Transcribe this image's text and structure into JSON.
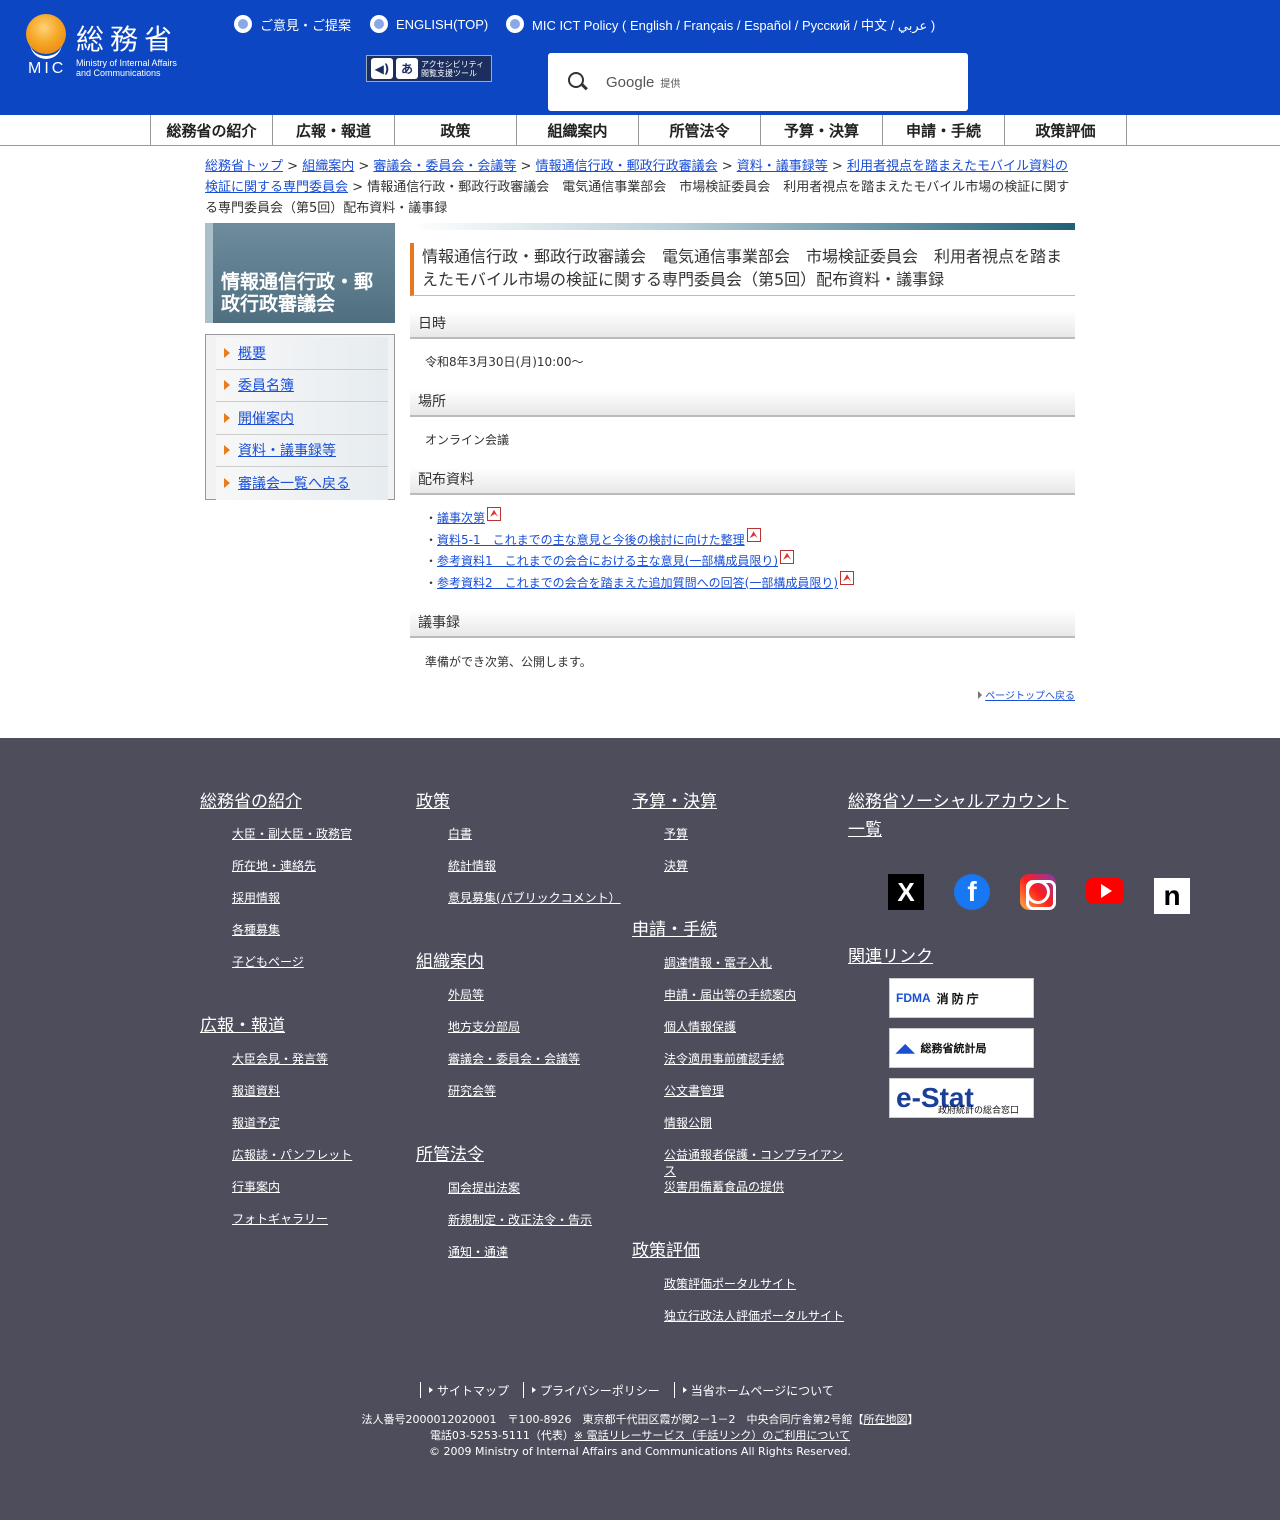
{
  "header": {
    "logo_kanji": "総務省",
    "logo_mic": "MIC",
    "logo_en_1": "Ministry of Internal Affairs",
    "logo_en_2": "and Communications",
    "links": [
      "ご意見・ご提案",
      "ENGLISH(TOP)",
      "MIC ICT Policy ( English / Français / Español / Русский / 中文 / عربي )"
    ],
    "access_tool_label_1": "アクセシビリティ",
    "access_tool_label_2": "閲覧支援ツール",
    "search_brand": "Google",
    "search_provided": "提供"
  },
  "gnav": [
    "総務省の紹介",
    "広報・報道",
    "政策",
    "組織案内",
    "所管法令",
    "予算・決算",
    "申請・手続",
    "政策評価"
  ],
  "breadcrumb": {
    "links": [
      "総務省トップ",
      "組織案内",
      "審議会・委員会・会議等",
      "情報通信行政・郵政行政審議会",
      "資料・議事録等",
      "利用者視点を踏まえたモバイル資料の検証に関する専門委員会"
    ],
    "separator": " > ",
    "current": "情報通信行政・郵政行政審議会　電気通信事業部会　市場検証委員会　利用者視点を踏まえたモバイル市場の検証に関する専門委員会（第5回）配布資料・議事録"
  },
  "side": {
    "title": "情報通信行政・郵政行政審議会",
    "menu": [
      "概要",
      "委員名簿",
      "開催案内",
      "資料・議事録等",
      "審議会一覧へ戻る"
    ]
  },
  "main": {
    "title": "情報通信行政・郵政行政審議会　電気通信事業部会　市場検証委員会　利用者視点を踏まえたモバイル市場の検証に関する専門委員会（第5回）配布資料・議事録",
    "date_heading": "日時",
    "date_value": "令和8年3月30日(月)10:00～",
    "place_heading": "場所",
    "place_value": "オンライン会議",
    "docs_heading": "配布資料",
    "bullet": "・",
    "docs": [
      "議事次第",
      "資料5-1　これまでの主な意見と今後の検討に向けた整理",
      "参考資料1　これまでの会合における主な意見(一部構成員限り)",
      "参考資料2　これまでの会合を踏まえた追加質問への回答(一部構成員限り)"
    ],
    "minutes_heading": "議事録",
    "minutes_value": "準備ができ次第、公開します。",
    "page_top": "ページトップへ戻る"
  },
  "footer": {
    "col1": {
      "sections": [
        {
          "heading": "総務省の紹介",
          "items": [
            "大臣・副大臣・政務官",
            "所在地・連絡先",
            "採用情報",
            "各種募集",
            "子どもページ"
          ]
        },
        {
          "heading": "広報・報道",
          "items": [
            "大臣会見・発言等",
            "報道資料",
            "報道予定",
            "広報誌・パンフレット",
            "行事案内",
            "フォトギャラリー"
          ]
        }
      ]
    },
    "col2": {
      "sections": [
        {
          "heading": "政策",
          "items": [
            "白書",
            "統計情報",
            "意見募集(パブリックコメント）"
          ]
        },
        {
          "heading": "組織案内",
          "items": [
            "外局等",
            "地方支分部局",
            "審議会・委員会・会議等",
            "研究会等"
          ]
        },
        {
          "heading": "所管法令",
          "items": [
            "国会提出法案",
            "新規制定・改正法令・告示",
            "通知・通達"
          ]
        }
      ]
    },
    "col3": {
      "sections": [
        {
          "heading": "予算・決算",
          "items": [
            "予算",
            "決算"
          ]
        },
        {
          "heading": "申請・手続",
          "items": [
            "調達情報・電子入札",
            "申請・届出等の手続案内",
            "個人情報保護",
            "法令適用事前確認手続",
            "公文書管理",
            "情報公開",
            "公益通報者保護・コンプライアンス",
            "災害用備蓄食品の提供"
          ]
        },
        {
          "heading": "政策評価",
          "items": [
            "政策評価ポータルサイト",
            "独立行政法人評価ポータルサイト"
          ]
        }
      ]
    },
    "social_heading": "総務省ソーシャルアカウント一覧",
    "social_icons": [
      "x-icon",
      "facebook-icon",
      "instagram-icon",
      "youtube-icon",
      "note-icon"
    ],
    "social_glyph_x": "X",
    "social_glyph_fb": "f",
    "social_glyph_note": "n",
    "related_heading": "関連リンク",
    "banners": {
      "fdma_mark": "FDMA",
      "fdma_text": "消防庁",
      "stat_text": "総務省統計局",
      "estat_text": "e-Stat",
      "estat_sub": "政府統計の総合窓口"
    },
    "bottom_links": [
      "サイトマップ",
      "プライバシーポリシー",
      "当省ホームページについて"
    ],
    "address_line1_prefix": "法人番号2000012020001　〒100-8926　東京都千代田区霞が関2－1－2　中央合同庁舎第2号館【",
    "address_line1_link": "所在地図",
    "address_line1_suffix": "】",
    "address_line2_prefix": "電話03-5253-5111（代表）",
    "address_line2_link": "※ 電話リレーサービス（手話リンク）のご利用について",
    "copyright": "© 2009 Ministry of Internal Affairs and Communications All Rights Reserved."
  }
}
